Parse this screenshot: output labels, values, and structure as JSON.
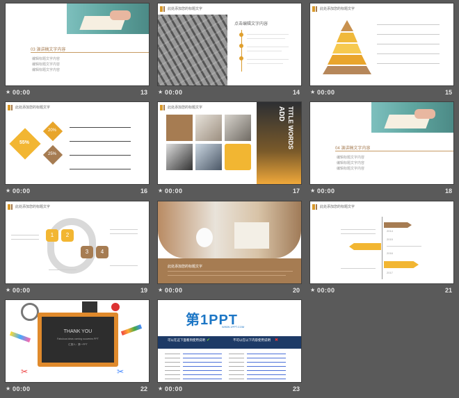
{
  "slides": [
    {
      "number": "13",
      "time": "00:00",
      "title": "03 演讲稿文字内容",
      "lines": [
        "编辑标题文字内容",
        "编辑标题文字内容",
        "编辑标题文字内容"
      ]
    },
    {
      "number": "14",
      "time": "00:00",
      "header": "此处添加您的标题文字",
      "title": "点击编辑文字内容"
    },
    {
      "number": "15",
      "time": "00:00",
      "header": "此处添加您的标题文字"
    },
    {
      "number": "16",
      "time": "00:00",
      "header": "此处添加您的标题文字",
      "percents": [
        "55%",
        "20%",
        "25%"
      ]
    },
    {
      "number": "17",
      "time": "00:00",
      "header": "此处添加您的标题文字",
      "vertical": [
        "ADD",
        "TITLE WORDS"
      ]
    },
    {
      "number": "18",
      "time": "00:00",
      "title": "04 演讲稿文字内容",
      "lines": [
        "编辑标题文字内容",
        "编辑标题文字内容",
        "编辑标题文字内容"
      ]
    },
    {
      "number": "19",
      "time": "00:00",
      "header": "此处添加您的标题文字",
      "steps": [
        "1",
        "2",
        "3",
        "4"
      ]
    },
    {
      "number": "20",
      "time": "00:00",
      "caption": "此处添加您的标题文字"
    },
    {
      "number": "21",
      "time": "00:00",
      "header": "此处添加您的标题文字",
      "years": [
        "2014",
        "2015",
        "2016",
        "2017"
      ]
    },
    {
      "number": "22",
      "time": "00:00",
      "board": [
        "THANK YOU",
        "Fabulous ideas coming souvenirs PPT",
        "汇报人：第一PPT"
      ]
    },
    {
      "number": "23",
      "time": "00:00",
      "logo": "第1PPT",
      "url": "WWW.1PPT.COM",
      "left_head": "可以在这下面看到使用说明",
      "right_head": "不可以在以下内容使用说明"
    }
  ],
  "colors": {
    "accent": "#e0a02e",
    "brown": "#a67c52",
    "gray_bg": "#5a5a5a"
  },
  "icons": {
    "meta_icon": "star-icon"
  }
}
